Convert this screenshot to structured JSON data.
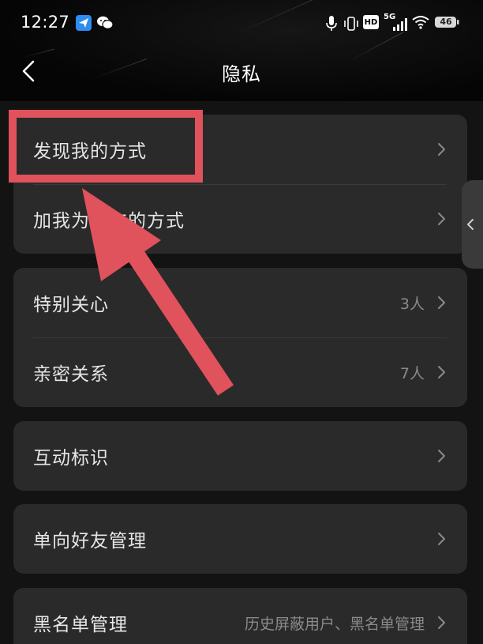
{
  "status_bar": {
    "time": "12:27",
    "network": "5G",
    "hd_badge": "HD",
    "battery": "46"
  },
  "nav": {
    "title": "隐私"
  },
  "sections": [
    {
      "rows": [
        {
          "id": "discover",
          "label": "发现我的方式",
          "value": ""
        },
        {
          "id": "add-friend",
          "label": "加我为好友的方式",
          "value": ""
        }
      ]
    },
    {
      "rows": [
        {
          "id": "special-care",
          "label": "特别关心",
          "value": "3人"
        },
        {
          "id": "intimate",
          "label": "亲密关系",
          "value": "7人"
        }
      ]
    },
    {
      "rows": [
        {
          "id": "interaction-marks",
          "label": "互动标识",
          "value": ""
        }
      ]
    },
    {
      "rows": [
        {
          "id": "one-way-friends",
          "label": "单向好友管理",
          "value": ""
        }
      ]
    },
    {
      "rows": [
        {
          "id": "blacklist",
          "label": "黑名单管理",
          "value": "历史屏蔽用户、黑名单管理"
        }
      ]
    }
  ],
  "colors": {
    "background": "#131313",
    "card": "#2a2a2a",
    "annotation": "#e0525c"
  }
}
